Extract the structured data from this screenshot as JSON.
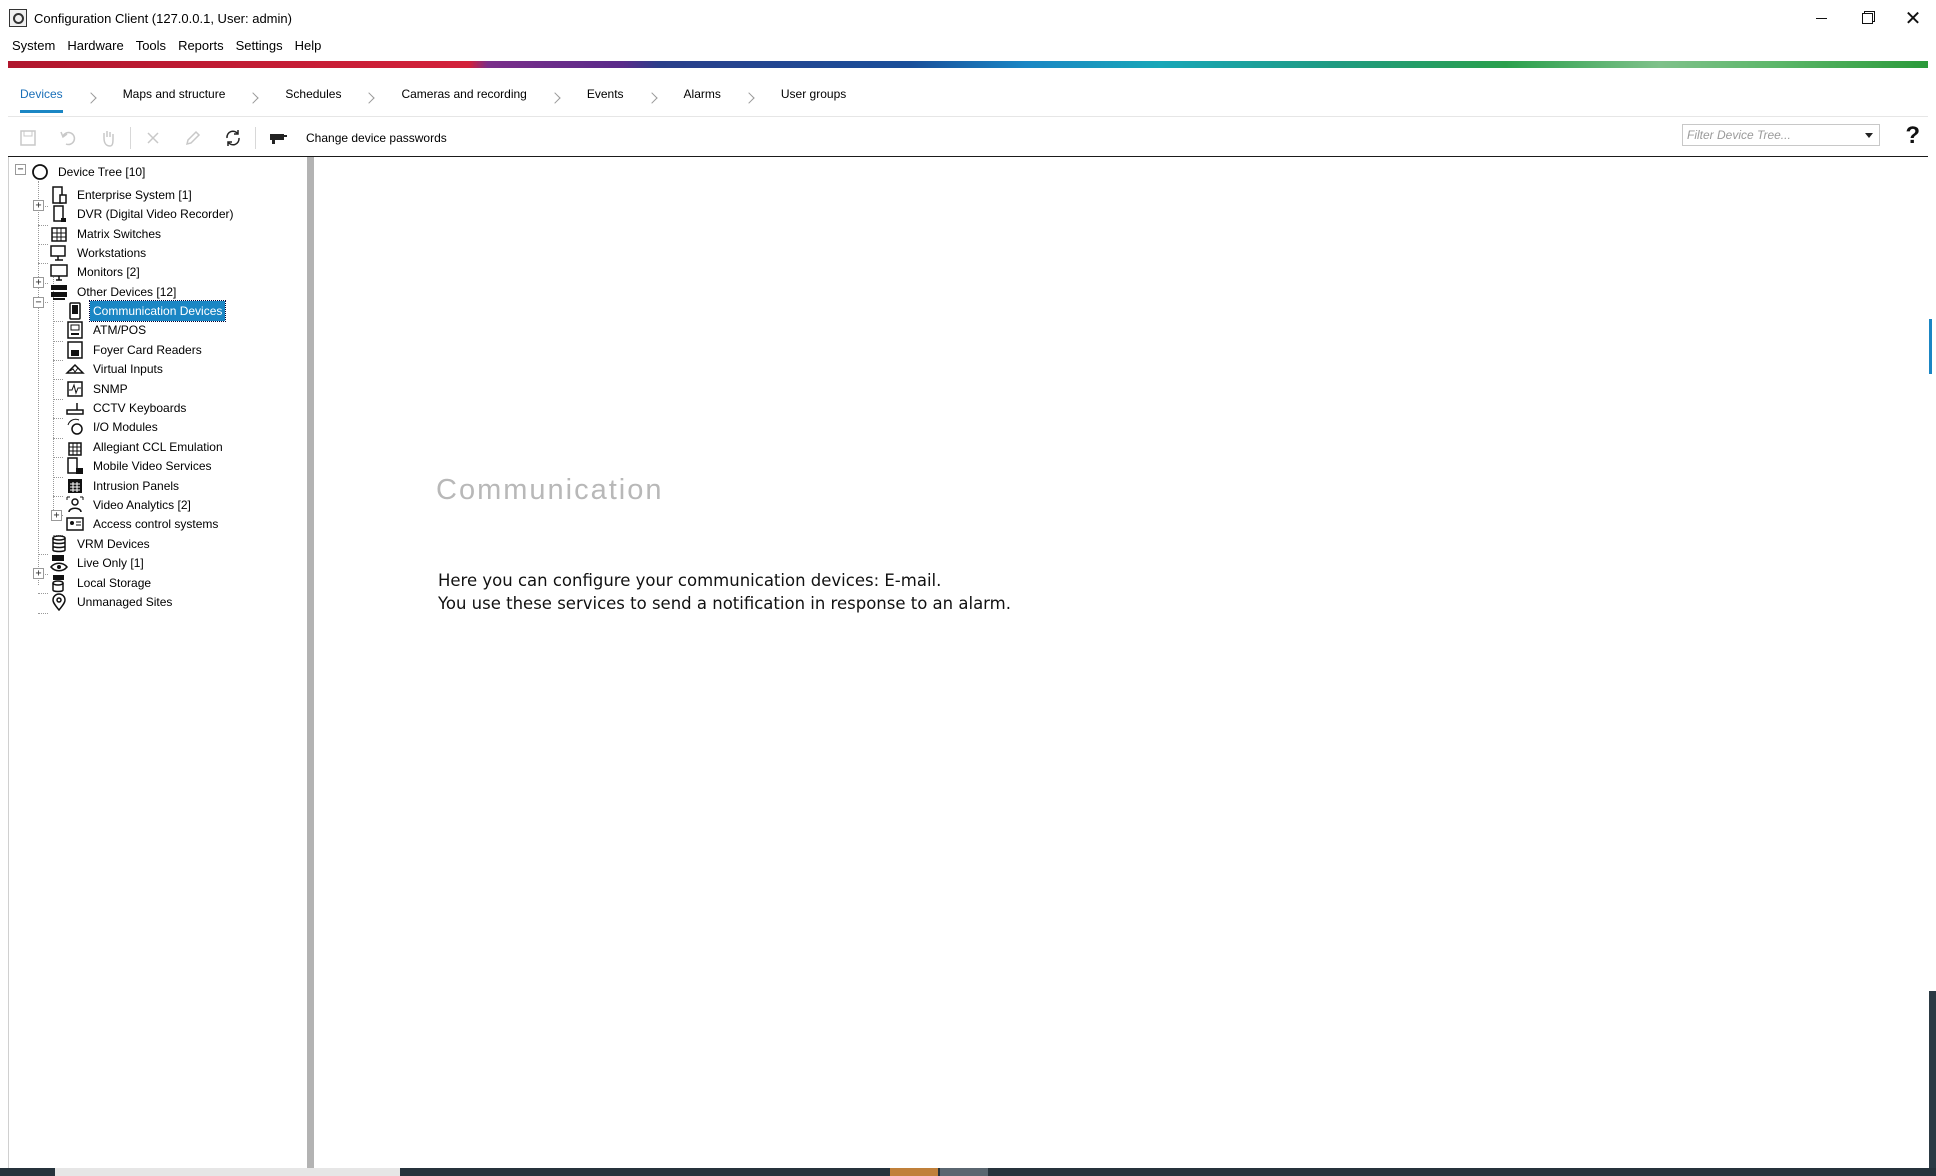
{
  "window": {
    "title": "Configuration Client (127.0.0.1, User: admin)",
    "controls": {
      "minimize": "",
      "maximize": "",
      "close": "✕"
    }
  },
  "menu": {
    "items": [
      "System",
      "Hardware",
      "Tools",
      "Reports",
      "Settings",
      "Help"
    ]
  },
  "workflow": {
    "active": "Devices",
    "tabs": [
      "Devices",
      "Maps and structure",
      "Schedules",
      "Cameras and recording",
      "Events",
      "Alarms",
      "User groups"
    ]
  },
  "toolbar": {
    "change_passwords_label": "Change device passwords",
    "filter_placeholder": "Filter Device Tree...",
    "help_label": "?",
    "icons": [
      "save-icon",
      "undo-icon",
      "hand-icon",
      "delete-icon",
      "edit-icon",
      "refresh-icon",
      "password-icon"
    ]
  },
  "tree": {
    "root": {
      "label": "Device Tree [10]",
      "icon": "globe-icon"
    },
    "items": [
      {
        "label": "Enterprise System [1]",
        "icon": "enterprise-icon"
      },
      {
        "label": "DVR (Digital Video Recorder)",
        "icon": "dvr-icon"
      },
      {
        "label": "Matrix Switches",
        "icon": "matrix-icon"
      },
      {
        "label": "Workstations",
        "icon": "workstation-icon"
      },
      {
        "label": "Monitors [2]",
        "icon": "monitor-icon"
      },
      {
        "label": "Other Devices [12]",
        "icon": "other-devices-icon"
      },
      {
        "label": "Communication Devices",
        "icon": "phone-icon",
        "selected": true
      },
      {
        "label": "ATM/POS",
        "icon": "atm-icon"
      },
      {
        "label": "Foyer Card Readers",
        "icon": "card-reader-icon"
      },
      {
        "label": "Virtual Inputs",
        "icon": "virtual-input-icon"
      },
      {
        "label": "SNMP",
        "icon": "snmp-icon"
      },
      {
        "label": "CCTV Keyboards",
        "icon": "keyboard-icon"
      },
      {
        "label": "I/O Modules",
        "icon": "io-module-icon"
      },
      {
        "label": "Allegiant CCL Emulation",
        "icon": "ccl-icon"
      },
      {
        "label": "Mobile Video Services",
        "icon": "mobile-video-icon"
      },
      {
        "label": "Intrusion Panels",
        "icon": "intrusion-panel-icon"
      },
      {
        "label": "Video Analytics [2]",
        "icon": "analytics-icon"
      },
      {
        "label": "Access control systems",
        "icon": "access-control-icon"
      },
      {
        "label": "VRM Devices",
        "icon": "vrm-icon"
      },
      {
        "label": "Live Only [1]",
        "icon": "live-only-icon"
      },
      {
        "label": "Local Storage",
        "icon": "local-storage-icon"
      },
      {
        "label": "Unmanaged Sites",
        "icon": "location-pin-icon"
      }
    ]
  },
  "content": {
    "title": "Communication",
    "line1": "Here you can configure your communication devices: E-mail.",
    "line2": "You use these services to send a notification in response to an alarm."
  }
}
